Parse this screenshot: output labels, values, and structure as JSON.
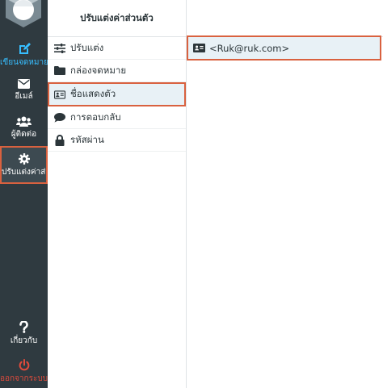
{
  "nav": {
    "compose_label": "เขียนจดหมายใหม่",
    "mail_label": "อีเมล์",
    "contacts_label": "ผู้ติดต่อ",
    "settings_label": "ปรับแต่งค่าส่วนตัว",
    "about_label": "เกี่ยวกับ",
    "logout_label": "ออกจากระบบ"
  },
  "settings": {
    "header": "ปรับแต่งค่าส่วนตัว",
    "items": [
      {
        "label": "ปรับแต่ง",
        "icon": "sliders-icon"
      },
      {
        "label": "กล่องจดหมาย",
        "icon": "folder-icon"
      },
      {
        "label": "ชื่อแสดงตัว",
        "icon": "id-card-icon",
        "selected": true
      },
      {
        "label": "การตอบกลับ",
        "icon": "comment-icon"
      },
      {
        "label": "รหัสผ่าน",
        "icon": "lock-icon"
      }
    ]
  },
  "identities": {
    "items": [
      {
        "label": "<Ruk@ruk.com>",
        "icon": "id-card-icon",
        "selected": true
      }
    ]
  },
  "colors": {
    "rail_bg": "#2f3a40",
    "accent": "#37beff",
    "highlight_border": "#d9613f",
    "selected_bg": "#e8f1f6",
    "logout": "#e04b3c"
  }
}
